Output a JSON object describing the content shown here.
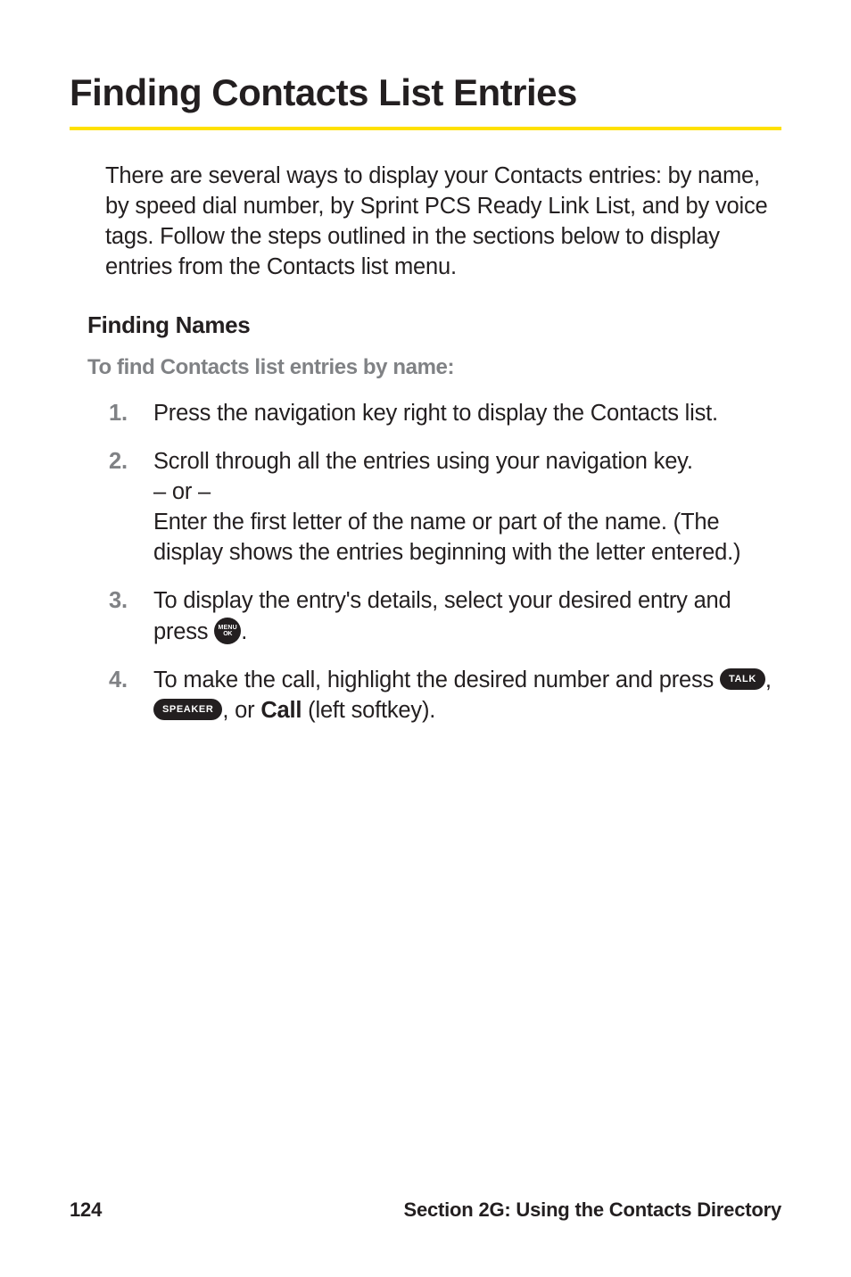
{
  "title": "Finding Contacts List Entries",
  "intro": "There are several ways to display your Contacts entries: by name, by speed dial number, by Sprint PCS Ready Link List, and by voice tags. Follow the steps outlined in the sections below to display entries from the Contacts list menu.",
  "subheading": "Finding Names",
  "subsub": "To find Contacts list entries by name:",
  "steps": [
    {
      "num": "1.",
      "text": "Press the navigation key right to display the Contacts list."
    },
    {
      "num": "2.",
      "part_a": "Scroll through all the entries using your navigation key.",
      "or": "– or –",
      "part_b": "Enter the first letter of the name or part of the name. (The display shows the entries beginning with the letter entered.)"
    },
    {
      "num": "3.",
      "pre": "To display the entry's details, select your desired entry and press ",
      "post": "."
    },
    {
      "num": "4.",
      "pre": "To make the call, highlight the desired number and press ",
      "sep1": ", ",
      "sep2": ", or ",
      "call_label": "Call",
      "post": " (left softkey)."
    }
  ],
  "icons": {
    "menu_top": "MENU",
    "menu_ok": "OK",
    "talk": "TALK",
    "speaker": "SPEAKER"
  },
  "footer": {
    "page": "124",
    "section": "Section 2G: Using the Contacts Directory"
  }
}
